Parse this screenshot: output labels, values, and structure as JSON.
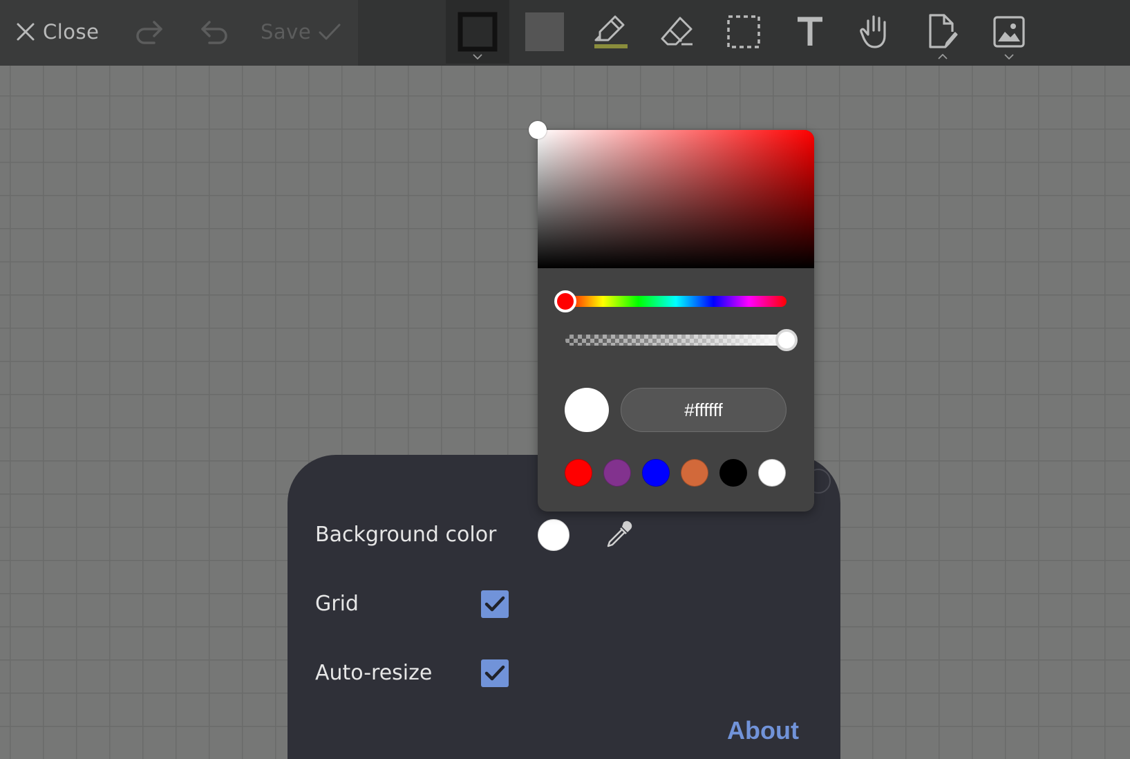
{
  "toolbar": {
    "close_label": "Close",
    "save_label": "Save"
  },
  "tools": [
    {
      "name": "stroke-color-tool",
      "icon": "square-outline-icon"
    },
    {
      "name": "fill-color-tool",
      "icon": "filled-square-icon"
    },
    {
      "name": "highlighter-tool",
      "icon": "highlighter-icon"
    },
    {
      "name": "eraser-tool",
      "icon": "eraser-icon"
    },
    {
      "name": "selection-tool",
      "icon": "dashed-rectangle-icon"
    },
    {
      "name": "text-tool",
      "icon": "text-icon"
    },
    {
      "name": "pan-tool",
      "icon": "hand-icon"
    },
    {
      "name": "page-tool",
      "icon": "document-edit-icon"
    },
    {
      "name": "image-tool",
      "icon": "image-icon"
    }
  ],
  "colors": {
    "toolbar_bg": "#333434",
    "canvas_bg": "#767776",
    "panel_bg": "#2f3038",
    "accent": "#7193d9",
    "picker_bg": "#424242"
  },
  "color_picker": {
    "hex_value": "#ffffff",
    "hue": "#ff0000",
    "alpha": 1.0,
    "presets": [
      "#ff0000",
      "#82328e",
      "#0000ff",
      "#d2693a",
      "#000000",
      "#ffffff"
    ]
  },
  "settings": {
    "background_color_label": "Background color",
    "background_color_value": "#ffffff",
    "grid_label": "Grid",
    "grid_checked": true,
    "auto_resize_label": "Auto-resize",
    "auto_resize_checked": true,
    "about_label": "About"
  }
}
